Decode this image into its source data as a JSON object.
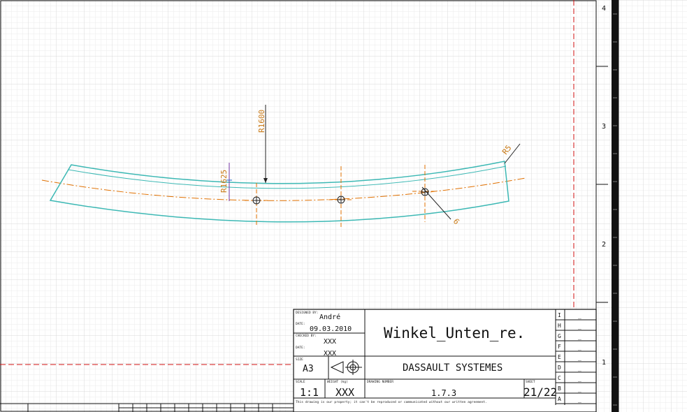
{
  "drawing": {
    "dimensions": {
      "radius_1600": "R1600",
      "radius_1625": "R1625",
      "radius_5": "R5",
      "diameter_6": "6"
    }
  },
  "zone_numbers": [
    "4",
    "3",
    "2",
    "1"
  ],
  "row_letters": [
    "I",
    "H",
    "G",
    "F",
    "E",
    "D",
    "C",
    "B",
    "A"
  ],
  "title_block": {
    "designed_by_label": "DESIGNED BY:",
    "designed_by": "André",
    "date_label_1": "DATE:",
    "date_1": "09.03.2010",
    "checked_by_label": "CHECKED BY:",
    "checked_by": "XXX",
    "date_label_2": "DATE:",
    "date_2": "XXX",
    "size_label": "SIZE",
    "size": "A3",
    "title": "Winkel_Unten_re.",
    "company": "DASSAULT SYSTEMES",
    "scale_label": "SCALE",
    "scale": "1:1",
    "weight_label": "WEIGHT (kg)",
    "weight": "XXX",
    "drawing_number_label": "DRAWING NUMBER",
    "drawing_number": "1.7.3",
    "sheet_label": "SHEET",
    "sheet": "21/22",
    "copyright": "This drawing is our property; it can't be reproduced or communicated without our written agreement.",
    "revision_mark": "_"
  },
  "colors": {
    "part_outline": "#3cb8b4",
    "dimension": "#c87814",
    "centerline": "#e07000",
    "frame_red": "#d01010",
    "grid_line": "#e4e4e4"
  }
}
